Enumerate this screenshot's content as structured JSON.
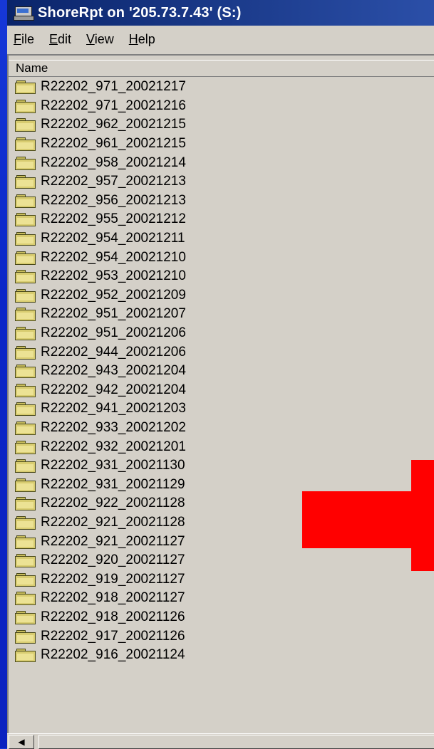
{
  "window": {
    "title": "ShoreRpt on '205.73.7.43' (S:)"
  },
  "menu": [
    {
      "pre": "",
      "u": "F",
      "post": "ile"
    },
    {
      "pre": "",
      "u": "E",
      "post": "dit"
    },
    {
      "pre": "",
      "u": "V",
      "post": "iew"
    },
    {
      "pre": "",
      "u": "H",
      "post": "elp"
    }
  ],
  "list": {
    "column_header": "Name",
    "items": [
      "R22202_971_20021217",
      "R22202_971_20021216",
      "R22202_962_20021215",
      "R22202_961_20021215",
      "R22202_958_20021214",
      "R22202_957_20021213",
      "R22202_956_20021213",
      "R22202_955_20021212",
      "R22202_954_20021211",
      "R22202_954_20021210",
      "R22202_953_20021210",
      "R22202_952_20021209",
      "R22202_951_20021207",
      "R22202_951_20021206",
      "R22202_944_20021206",
      "R22202_943_20021204",
      "R22202_942_20021204",
      "R22202_941_20021203",
      "R22202_933_20021202",
      "R22202_932_20021201",
      "R22202_931_20021130",
      "R22202_931_20021129",
      "R22202_922_20021128",
      "R22202_921_20021128",
      "R22202_921_20021127",
      "R22202_920_20021127",
      "R22202_919_20021127",
      "R22202_918_20021127",
      "R22202_918_20021126",
      "R22202_917_20021126",
      "R22202_916_20021124"
    ]
  },
  "icons": {
    "title": "network-drive-icon",
    "item": "folder-icon",
    "scroll_left": "scroll-left-arrow-icon",
    "overlay": "red-arrow-icon"
  },
  "colors": {
    "desktop": "#0a26c8",
    "titlebar_start": "#0a246a",
    "window_face": "#d4d0c8",
    "arrow": "#ff0000"
  }
}
